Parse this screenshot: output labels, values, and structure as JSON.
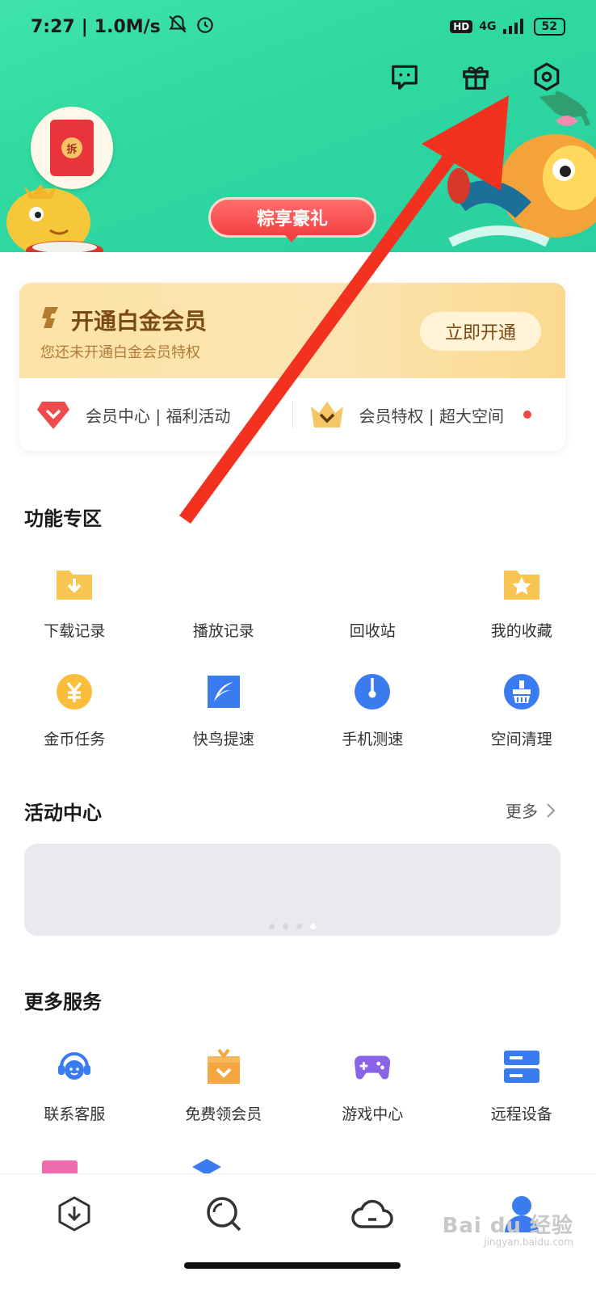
{
  "status_bar": {
    "time": "7:27",
    "speed": "1.0M/s",
    "network": "4G",
    "hd": "HD",
    "battery": "52"
  },
  "header": {
    "promo_label": "粽享豪礼",
    "envelope_text": "拆"
  },
  "vip": {
    "title": "开通白金会员",
    "subtitle": "您还未开通白金会员特权",
    "cta": "立即开通",
    "link1": "会员中心 | 福利活动",
    "link2": "会员特权 | 超大空间"
  },
  "features": {
    "title": "功能专区",
    "items": [
      {
        "label": "下载记录"
      },
      {
        "label": "播放记录"
      },
      {
        "label": "回收站"
      },
      {
        "label": "我的收藏"
      },
      {
        "label": "金币任务"
      },
      {
        "label": "快鸟提速"
      },
      {
        "label": "手机测速"
      },
      {
        "label": "空间清理"
      }
    ]
  },
  "activity": {
    "title": "活动中心",
    "more": "更多"
  },
  "services": {
    "title": "更多服务",
    "items": [
      {
        "label": "联系客服"
      },
      {
        "label": "免费领会员"
      },
      {
        "label": "游戏中心"
      },
      {
        "label": "远程设备"
      }
    ]
  },
  "watermark": {
    "main": "Bai du 经验",
    "sub": "jingyan.baidu.com"
  },
  "colors": {
    "header_green": "#2fd9a0",
    "promo_red": "#f44243",
    "vip_gold": "#fbe4b0",
    "arrow_red": "#f2321f",
    "accent_blue": "#3a7cf0"
  }
}
